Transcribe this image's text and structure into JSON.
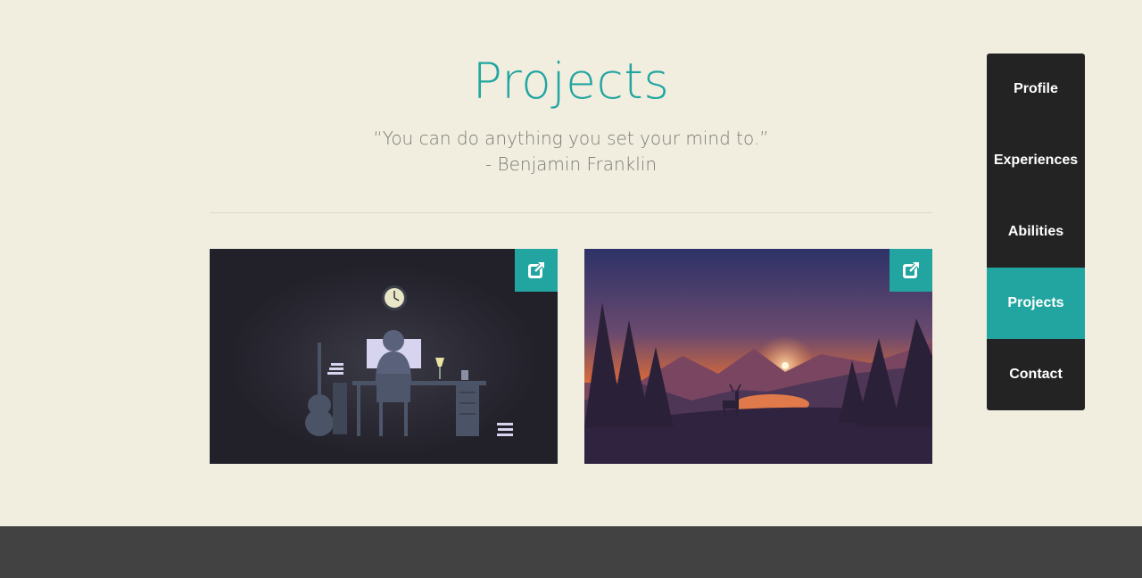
{
  "section": {
    "title": "Projects",
    "quote_line1": "“You can do anything you set your mind to.”",
    "quote_line2": "- Benjamin Franklin"
  },
  "projects": [
    {
      "image_icon": "night-desk-illustration",
      "link_icon": "external-link-icon"
    },
    {
      "image_icon": "sunset-deer-landscape",
      "link_icon": "external-link-icon"
    }
  ],
  "nav": {
    "items": [
      "Profile",
      "Experiences",
      "Abilities",
      "Projects",
      "Contact"
    ],
    "active": "Projects"
  },
  "colors": {
    "accent": "#22a5a0",
    "background": "#f1eee0",
    "nav_bg": "#232323",
    "footer_bg": "#424242"
  }
}
